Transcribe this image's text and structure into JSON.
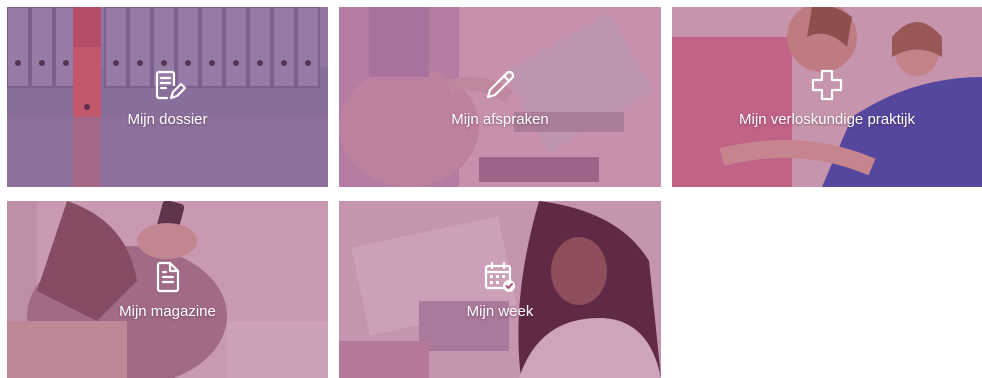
{
  "tiles": [
    {
      "label": "Mijn dossier",
      "icon": "document-edit-icon"
    },
    {
      "label": "Mijn afspraken",
      "icon": "pencil-icon"
    },
    {
      "label": "Mijn verloskundige praktijk",
      "icon": "medical-cross-icon"
    },
    {
      "label": "Mijn magazine",
      "icon": "document-icon"
    },
    {
      "label": "Mijn week",
      "icon": "calendar-check-icon"
    }
  ],
  "colors": {
    "overlay": "#963c6e",
    "text": "#ffffff"
  }
}
